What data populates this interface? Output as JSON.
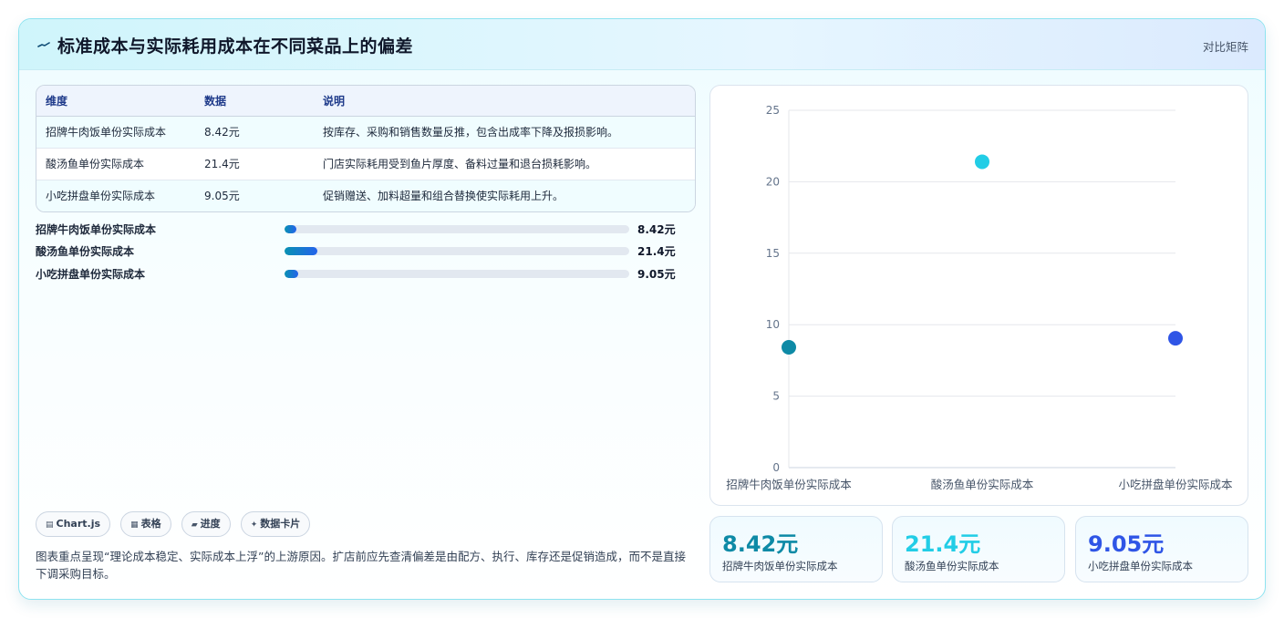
{
  "header": {
    "title": "标准成本与实际耗用成本在不同菜品上的偏差",
    "right_label": "对比矩阵",
    "icon": "trend-line-icon"
  },
  "table": {
    "headers": [
      "维度",
      "数据",
      "说明"
    ],
    "rows": [
      {
        "dim": "招牌牛肉饭单份实际成本",
        "value": "8.42元",
        "desc": "按库存、采购和销售数量反推，包含出成率下降及报损影响。"
      },
      {
        "dim": "酸汤鱼单份实际成本",
        "value": "21.4元",
        "desc": "门店实际耗用受到鱼片厚度、备料过量和退台损耗影响。"
      },
      {
        "dim": "小吃拼盘单份实际成本",
        "value": "9.05元",
        "desc": "促销赠送、加料超量和组合替换使实际耗用上升。"
      }
    ]
  },
  "progress": [
    {
      "label": "招牌牛肉饭单份实际成本",
      "value_text": "8.42元",
      "fraction": 0.035
    },
    {
      "label": "酸汤鱼单份实际成本",
      "value_text": "21.4元",
      "fraction": 0.095
    },
    {
      "label": "小吃拼盘单份实际成本",
      "value_text": "9.05元",
      "fraction": 0.04
    }
  ],
  "tags": [
    {
      "icon": "grid-icon",
      "glyph": "▤",
      "label": "Chart.js"
    },
    {
      "icon": "table-icon",
      "glyph": "▦",
      "label": "表格"
    },
    {
      "icon": "progress-icon",
      "glyph": "▰",
      "label": "进度"
    },
    {
      "icon": "sparkle-icon",
      "glyph": "✦",
      "label": "数据卡片"
    }
  ],
  "note": "图表重点呈现“理论成本稳定、实际成本上浮”的上游原因。扩店前应先查清偏差是由配方、执行、库存还是促销造成，而不是直接下调采购目标。",
  "stats": [
    {
      "value": "8.42元",
      "label": "招牌牛肉饭单份实际成本",
      "color": "#0e8aa6"
    },
    {
      "value": "21.4元",
      "label": "酸汤鱼单份实际成本",
      "color": "#22cde6"
    },
    {
      "value": "9.05元",
      "label": "小吃拼盘单份实际成本",
      "color": "#2f55e6"
    }
  ],
  "chart_data": {
    "type": "scatter",
    "categories": [
      "招牌牛肉饭单份实际成本",
      "酸汤鱼单份实际成本",
      "小吃拼盘单份实际成本"
    ],
    "values": [
      8.42,
      21.4,
      9.05
    ],
    "point_colors": [
      "#0e8aa6",
      "#22cde6",
      "#2f55e6"
    ],
    "ylim": [
      0,
      25
    ],
    "yticks": [
      0,
      5,
      10,
      15,
      20,
      25
    ],
    "grid": true,
    "title": "",
    "xlabel": "",
    "ylabel": ""
  }
}
